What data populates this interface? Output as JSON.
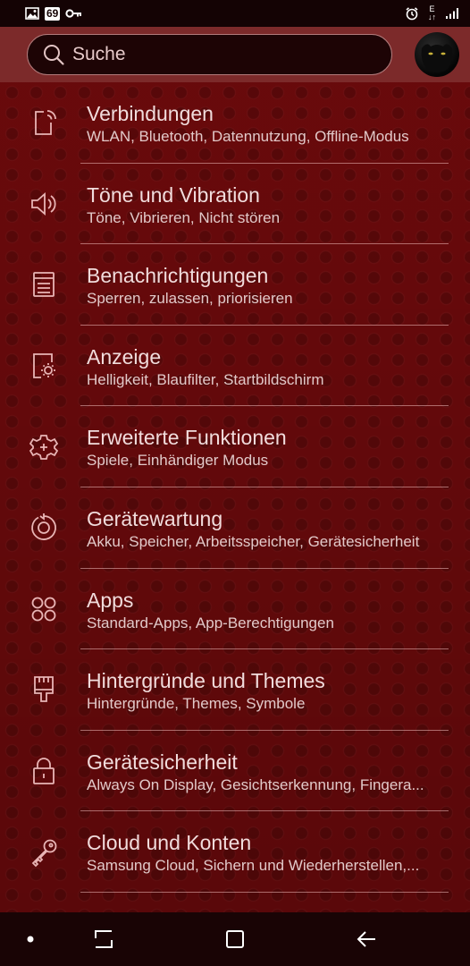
{
  "status_bar": {
    "battery": "69",
    "network": "E",
    "network_sub": "↓↑",
    "icons": [
      "image-icon",
      "battery-icon",
      "key-icon",
      "alarm-icon",
      "network-icon",
      "signal-icon"
    ]
  },
  "search": {
    "placeholder": "Suche"
  },
  "colors": {
    "background": "#6e0a0c",
    "header": "#7c2a2a",
    "search_box": "#1d0405",
    "text_primary": "#f1dcdc",
    "icon": "#e8b5b5"
  },
  "settings": [
    {
      "title": "Verbindungen",
      "subtitle": "WLAN, Bluetooth, Datennutzung, Offline-Modus",
      "icon": "connections-icon"
    },
    {
      "title": "Töne und Vibration",
      "subtitle": "Töne, Vibrieren, Nicht stören",
      "icon": "speaker-icon"
    },
    {
      "title": "Benachrichtigungen",
      "subtitle": "Sperren, zulassen, priorisieren",
      "icon": "notifications-icon"
    },
    {
      "title": "Anzeige",
      "subtitle": "Helligkeit, Blaufilter, Startbildschirm",
      "icon": "display-brightness-icon"
    },
    {
      "title": "Erweiterte Funktionen",
      "subtitle": "Spiele, Einhändiger Modus",
      "icon": "gear-plus-icon"
    },
    {
      "title": "Gerätewartung",
      "subtitle": "Akku, Speicher, Arbeitsspeicher, Gerätesicherheit",
      "icon": "device-care-icon"
    },
    {
      "title": "Apps",
      "subtitle": "Standard-Apps, App-Berechtigungen",
      "icon": "apps-grid-icon"
    },
    {
      "title": "Hintergründe und Themes",
      "subtitle": "Hintergründe, Themes, Symbole",
      "icon": "paintbrush-icon"
    },
    {
      "title": "Gerätesicherheit",
      "subtitle": "Always On Display, Gesichtserkennung, Fingera...",
      "icon": "lock-icon"
    },
    {
      "title": "Cloud und Konten",
      "subtitle": "Samsung Cloud, Sichern und Wiederherstellen,...",
      "icon": "key-icon"
    }
  ],
  "nav_bar": [
    "nav-dot-icon",
    "recents-icon",
    "home-icon",
    "back-icon"
  ]
}
